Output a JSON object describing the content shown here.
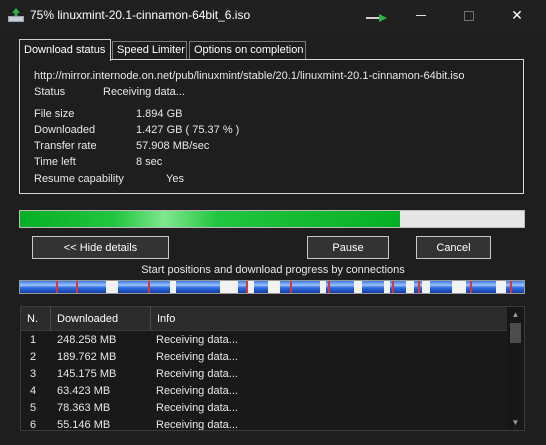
{
  "window": {
    "title": "75% linuxmint-20.1-cinnamon-64bit_6.iso",
    "close_glyph": "✕"
  },
  "tabs": [
    {
      "label": "Download status",
      "active": true
    },
    {
      "label": "Speed Limiter",
      "active": false
    },
    {
      "label": "Options on completion",
      "active": false
    }
  ],
  "status": {
    "url": "http://mirror.internode.on.net/pub/linuxmint/stable/20.1/linuxmint-20.1-cinnamon-64bit.iso",
    "status_label": "Status",
    "status_value": "Receiving data...",
    "file_size_label": "File size",
    "file_size_value": "1.894  GB",
    "downloaded_label": "Downloaded",
    "downloaded_value": "1.427  GB  ( 75.37 % )",
    "transfer_rate_label": "Transfer rate",
    "transfer_rate_value": "57.908  MB/sec",
    "time_left_label": "Time left",
    "time_left_value": "8 sec",
    "resume_label": "Resume capability",
    "resume_value": "Yes"
  },
  "progress": {
    "percent": 75.37,
    "color": "#06b025"
  },
  "buttons": {
    "hide_details": "<< Hide details",
    "pause": "Pause",
    "cancel": "Cancel"
  },
  "connections_caption": "Start positions and download progress by connections",
  "table": {
    "headers": {
      "n": "N.",
      "downloaded": "Downloaded",
      "info": "Info"
    },
    "rows": [
      {
        "n": "1",
        "downloaded": "248.258  MB",
        "info": "Receiving data..."
      },
      {
        "n": "2",
        "downloaded": "189.762  MB",
        "info": "Receiving data..."
      },
      {
        "n": "3",
        "downloaded": "145.175  MB",
        "info": "Receiving data..."
      },
      {
        "n": "4",
        "downloaded": "63.423  MB",
        "info": "Receiving data..."
      },
      {
        "n": "5",
        "downloaded": "78.363  MB",
        "info": "Receiving data..."
      },
      {
        "n": "6",
        "downloaded": "55.146  MB",
        "info": "Receiving data..."
      }
    ]
  },
  "icons": {
    "app": "download-manager-icon",
    "taskbar": "green-arrow-icon",
    "scroll_up": "▲",
    "scroll_down": "▼"
  }
}
